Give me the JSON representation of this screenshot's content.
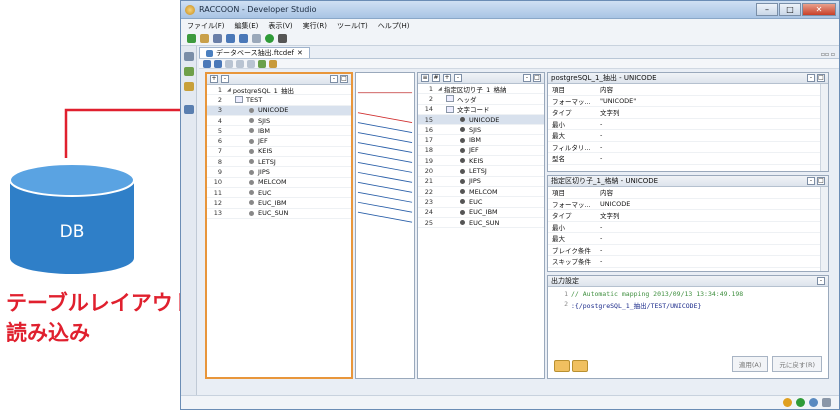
{
  "annotation": {
    "db_label": "DB",
    "caption_line1": "テーブルレイアウト",
    "caption_line2": "読み込み"
  },
  "window": {
    "title": "RACCOON - Developer Studio",
    "controls": {
      "minimize": "–",
      "maximize": "□",
      "close": "✕"
    }
  },
  "menu": [
    "ファイル(F)",
    "編集(E)",
    "表示(V)",
    "実行(R)",
    "ツール(T)",
    "ヘルプ(H)"
  ],
  "editor_tab": {
    "label": "データベース抽出.ftcdef",
    "close": "✕",
    "right_controls": "▫▫ ▫"
  },
  "left_panel": {
    "rows": [
      {
        "num": "1",
        "label": "postgreSQL_1_抽出",
        "kind": "root"
      },
      {
        "num": "2",
        "label": "TEST",
        "kind": "table"
      },
      {
        "num": "3",
        "label": "UNICODE",
        "kind": "field",
        "selected": true
      },
      {
        "num": "4",
        "label": "SJIS",
        "kind": "field"
      },
      {
        "num": "5",
        "label": "IBM",
        "kind": "field"
      },
      {
        "num": "6",
        "label": "JEF",
        "kind": "field"
      },
      {
        "num": "7",
        "label": "KEIS",
        "kind": "field"
      },
      {
        "num": "8",
        "label": "LETSJ",
        "kind": "field"
      },
      {
        "num": "9",
        "label": "JIPS",
        "kind": "field"
      },
      {
        "num": "10",
        "label": "MELCOM",
        "kind": "field"
      },
      {
        "num": "11",
        "label": "EUC",
        "kind": "field"
      },
      {
        "num": "12",
        "label": "EUC_IBM",
        "kind": "field"
      },
      {
        "num": "13",
        "label": "EUC_SUN",
        "kind": "field"
      }
    ]
  },
  "right_tree": {
    "rows": [
      {
        "num": "1",
        "label": "指定区切り子_1_格納",
        "kind": "root"
      },
      {
        "num": "2",
        "label": "ヘッダ",
        "kind": "group"
      },
      {
        "num": "14",
        "label": "文字コード",
        "kind": "group"
      },
      {
        "num": "15",
        "label": "UNICODE",
        "kind": "field",
        "selected": true
      },
      {
        "num": "16",
        "label": "SJIS",
        "kind": "field"
      },
      {
        "num": "17",
        "label": "IBM",
        "kind": "field"
      },
      {
        "num": "18",
        "label": "JEF",
        "kind": "field"
      },
      {
        "num": "19",
        "label": "KEIS",
        "kind": "field"
      },
      {
        "num": "20",
        "label": "LETSJ",
        "kind": "field"
      },
      {
        "num": "21",
        "label": "JIPS",
        "kind": "field"
      },
      {
        "num": "22",
        "label": "MELCOM",
        "kind": "field"
      },
      {
        "num": "23",
        "label": "EUC",
        "kind": "field"
      },
      {
        "num": "24",
        "label": "EUC_IBM",
        "kind": "field"
      },
      {
        "num": "25",
        "label": "EUC_SUN",
        "kind": "field"
      }
    ]
  },
  "props_top": {
    "title": "postgreSQL_1_抽出 - UNICODE",
    "header": [
      "項目",
      "内容"
    ],
    "rows": [
      [
        "フォーマッ...",
        "\"UNICODE\""
      ],
      [
        "タイプ",
        "文字列"
      ],
      [
        "最小",
        "-"
      ],
      [
        "最大",
        "-"
      ],
      [
        "フィルタリ...",
        "-"
      ],
      [
        "型名",
        "-"
      ]
    ]
  },
  "props_bottom": {
    "title": "指定区切り子_1_格納 - UNICODE",
    "header": [
      "項目",
      "内容"
    ],
    "rows": [
      [
        "フォーマッ...",
        "UNICODE"
      ],
      [
        "タイプ",
        "文字列"
      ],
      [
        "最小",
        "-"
      ],
      [
        "最大",
        "-"
      ],
      [
        "ブレイク条件",
        "-"
      ],
      [
        "スキップ条件",
        "-"
      ]
    ]
  },
  "output": {
    "title": "出力設定",
    "lines": [
      {
        "num": "1",
        "text": "// Automatic mapping 2013/09/13 13:34:49.198",
        "comment": true
      },
      {
        "num": "2",
        "text": ":{/postgreSQL_1_抽出/TEST/UNICODE}",
        "comment": false
      }
    ],
    "apply_label": "適用(A)",
    "revert_label": "元に戻す(R)"
  },
  "colors": {
    "accent": "#e0202e",
    "db_fill": "#2f7fc8",
    "selection": "#d8e1ed"
  }
}
